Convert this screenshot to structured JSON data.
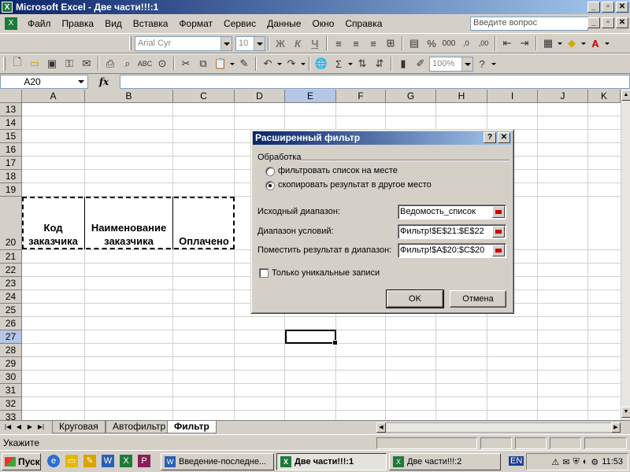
{
  "window": {
    "title": "Microsoft Excel - Две части!!!:1"
  },
  "menu": {
    "items": [
      "Файл",
      "Правка",
      "Вид",
      "Вставка",
      "Формат",
      "Сервис",
      "Данные",
      "Окно",
      "Справка"
    ],
    "ask_placeholder": "Введите вопрос"
  },
  "toolbar": {
    "font_name": "Arial Cyr",
    "font_size": "10",
    "bold": "Ж",
    "italic": "К",
    "underline": "Ч",
    "zoom": "100%"
  },
  "formula_bar": {
    "name_box": "A20",
    "fx": "fx",
    "formula": ""
  },
  "grid": {
    "columns": [
      "A",
      "B",
      "C",
      "D",
      "E",
      "F",
      "G",
      "H",
      "I",
      "J",
      "K"
    ],
    "rows": [
      "13",
      "14",
      "15",
      "16",
      "17",
      "18",
      "19",
      "20",
      "21",
      "22",
      "23",
      "24",
      "25",
      "26",
      "27",
      "28",
      "29",
      "30",
      "31",
      "32",
      "33"
    ],
    "selected_column": "E",
    "selected_row": "27",
    "header_cells": {
      "a20": "Код заказчика",
      "b20": "Наименование заказчика",
      "c20": "Оплачено"
    }
  },
  "sheet_tabs": [
    "Круговая",
    "Автофильтр",
    "Фильтр"
  ],
  "active_tab": "Фильтр",
  "status": {
    "text": "Укажите"
  },
  "dialog": {
    "title": "Расширенный фильтр",
    "group_label": "Обработка",
    "radio_filter_in_place": "фильтровать список на месте",
    "radio_copy_to": "скопировать результат в другое место",
    "source_range_label": "Исходный диапазон:",
    "source_range_value": "Ведомость_список",
    "criteria_range_label": "Диапазон условий:",
    "criteria_range_value": "Фильтр!$E$21:$E$22",
    "output_range_label": "Поместить результат в диапазон:",
    "output_range_value": "Фильтр!$A$20:$C$20",
    "unique_label": "Только уникальные записи",
    "ok_label": "OK",
    "cancel_label": "Отмена"
  },
  "taskbar": {
    "start_label": "Пуск",
    "tasks": [
      "Введение-последне...",
      "Две части!!!:1",
      "Две части!!!:2"
    ],
    "active_task": "Две части!!!:1",
    "lang": "EN",
    "clock": "11:53"
  }
}
